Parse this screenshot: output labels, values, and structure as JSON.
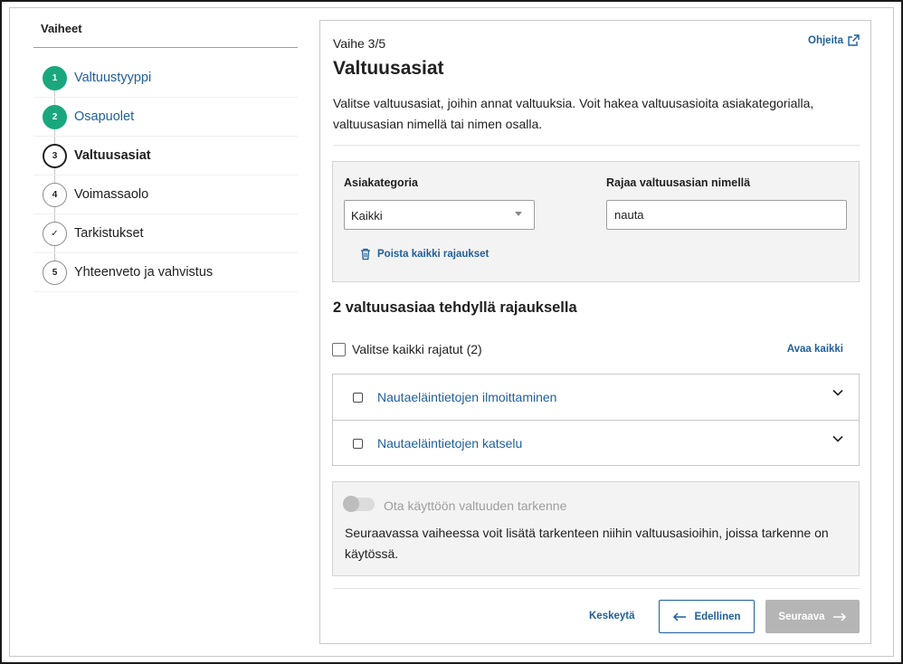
{
  "sidebar": {
    "title": "Vaiheet",
    "steps": [
      {
        "marker": "1",
        "label": "Valtuustyyppi",
        "state": "done"
      },
      {
        "marker": "2",
        "label": "Osapuolet",
        "state": "done"
      },
      {
        "marker": "3",
        "label": "Valtuusasiat",
        "state": "current"
      },
      {
        "marker": "4",
        "label": "Voimassaolo",
        "state": "todo"
      },
      {
        "marker": "✓",
        "label": "Tarkistukset",
        "state": "todo"
      },
      {
        "marker": "5",
        "label": "Yhteenveto ja vahvistus",
        "state": "todo"
      }
    ]
  },
  "header": {
    "step_counter": "Vaihe 3/5",
    "help_link": "Ohjeita",
    "help_icon": "external-link-icon",
    "title": "Valtuusasiat",
    "description": "Valitse valtuusasiat, joihin annat valtuuksia. Voit hakea valtuusasioita asiakategorialla, valtuusasian nimellä tai nimen osalla."
  },
  "filters": {
    "category_label": "Asiakategoria",
    "category_value": "Kaikki",
    "name_label": "Rajaa valtuusasian nimellä",
    "name_value": "nauta",
    "clear_label": "Poista kaikki rajaukset",
    "clear_icon": "trash-icon"
  },
  "results": {
    "title": "2 valtuusasiaa tehdyllä rajauksella",
    "select_all_label": "Valitse kaikki rajatut (2)",
    "open_all_label": "Avaa kaikki",
    "items": [
      {
        "label": "Nautaeläintietojen ilmoittaminen"
      },
      {
        "label": "Nautaeläintietojen katselu"
      }
    ]
  },
  "refinement": {
    "toggle_label": "Ota käyttöön valtuuden tarkenne",
    "toggle_on": false,
    "info_text": "Seuraavassa vaiheessa voit lisätä tarkenteen niihin valtuusasioihin, joissa tarkenne on käytössä."
  },
  "footer": {
    "cancel_label": "Keskeytä",
    "prev_label": "Edellinen",
    "next_label": "Seuraava"
  },
  "colors": {
    "done_step": "#1aa77e",
    "link": "#1f5f9a",
    "disabled_button": "#b5b5b5"
  }
}
